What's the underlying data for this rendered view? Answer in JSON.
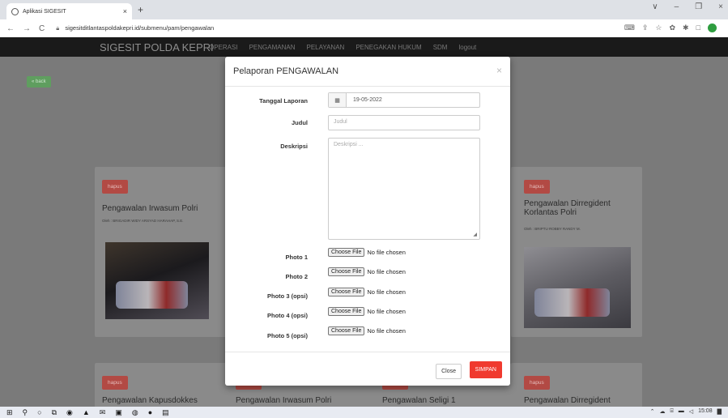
{
  "browser": {
    "tab_title": "Aplikasi SIGESIT",
    "tab_close": "×",
    "new_tab": "+",
    "url": "sigesitditlantaspoldakepri.id/submenu/pam/pengawalan",
    "window_controls": [
      "∨",
      "–",
      "❐",
      "×"
    ]
  },
  "site": {
    "brand": "SIGESIT POLDA KEPRI",
    "nav": [
      "OPERASI",
      "PENGAMANAN",
      "PELAYANAN",
      "PENEGAKAN HUKUM",
      "SDM",
      "logout"
    ],
    "back_label": "« back"
  },
  "cards": [
    {
      "hapus": "hapus",
      "title": "Pengawalan Irwasum Polri",
      "meta": "Oleh : BRIGADIR WIDY ARSYAD HARAHAP, S.E."
    },
    {
      "hapus": "hapus",
      "title": "Pengawalan Dirregident Korlantas Polri",
      "meta": "Oleh : BRIPTU ROBBY RANDY M."
    },
    {
      "hapus": "hapus",
      "title": "Pengawalan Kapusdokkes"
    },
    {
      "hapus": "hapus",
      "title": "Pengawalan Irwasum Polri"
    },
    {
      "hapus": "hapus",
      "title": "Pengawalan Seligi 1"
    },
    {
      "hapus": "hapus",
      "title": "Pengawalan Dirregident"
    }
  ],
  "modal": {
    "title": "Pelaporan PENGAWALAN",
    "close_x": "×",
    "fields": {
      "tanggal_label": "Tanggal Laporan",
      "tanggal_value": "19-05-2022",
      "judul_label": "Judul",
      "judul_placeholder": "Judul",
      "deskripsi_label": "Deskripsi",
      "deskripsi_placeholder": "Deskripsi ..."
    },
    "photos": [
      {
        "label": "Photo 1",
        "button": "Choose File",
        "status": "No file chosen"
      },
      {
        "label": "Photo 2",
        "button": "Choose File",
        "status": "No file chosen"
      },
      {
        "label": "Photo 3 (opsi)",
        "button": "Choose File",
        "status": "No file chosen"
      },
      {
        "label": "Photo 4 (opsi)",
        "button": "Choose File",
        "status": "No file chosen"
      },
      {
        "label": "Photo 5 (opsi)",
        "button": "Choose File",
        "status": "No file chosen"
      }
    ],
    "close_button": "Close",
    "save_button": "SIMPAN"
  },
  "taskbar": {
    "time": "15:08"
  },
  "icons": {
    "calendar": "calendar-icon",
    "lock": "lock-icon"
  }
}
